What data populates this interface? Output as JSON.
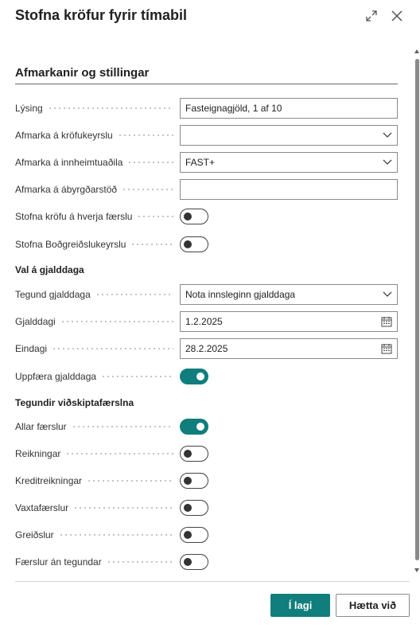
{
  "dialog": {
    "title": "Stofna kröfur fyrir tímabil",
    "expand_icon": "expand-icon",
    "close_icon": "close-icon"
  },
  "section": {
    "title": "Afmarkanir og stillingar"
  },
  "fields": {
    "description": {
      "label": "Lýsing",
      "value": "Fasteignagjöld, 1 af 10"
    },
    "claim_batch_filter": {
      "label": "Afmarka á kröfukeyrslu",
      "value": ""
    },
    "collection_party_filter": {
      "label": "Afmarka á innheimtuaðila",
      "value": "FAST+"
    },
    "responsibility_center_filter": {
      "label": "Afmarka á ábyrgðarstöð",
      "value": ""
    },
    "claim_per_entry": {
      "label": "Stofna kröfu á hverja færslu",
      "on": false
    },
    "payment_service_batch": {
      "label": "Stofna Boðgreiðslukeyrslu",
      "on": false
    }
  },
  "due_group": {
    "title": "Val á gjalddaga",
    "due_date_type": {
      "label": "Tegund gjalddaga",
      "value": "Nota innsleginn gjalddaga"
    },
    "due_date": {
      "label": "Gjalddagi",
      "value": "1.2.2025"
    },
    "final_date": {
      "label": "Eindagi",
      "value": "28.2.2025"
    },
    "update_due": {
      "label": "Uppfæra gjalddaga",
      "on": true
    }
  },
  "entry_types": {
    "title": "Tegundir viðskiptafærslna",
    "all": {
      "label": "Allar færslur",
      "on": true
    },
    "invoices": {
      "label": "Reikningar",
      "on": false
    },
    "credit_memos": {
      "label": "Kreditreikningar",
      "on": false
    },
    "interest": {
      "label": "Vaxtafærslur",
      "on": false
    },
    "payments": {
      "label": "Greiðslur",
      "on": false
    },
    "no_type": {
      "label": "Færslur án tegundar",
      "on": false
    }
  },
  "footer": {
    "ok_label": "Í lagi",
    "cancel_label": "Hætta við"
  },
  "colors": {
    "accent": "#0f7e7c",
    "text": "#212121",
    "border": "#8a8a8a"
  }
}
